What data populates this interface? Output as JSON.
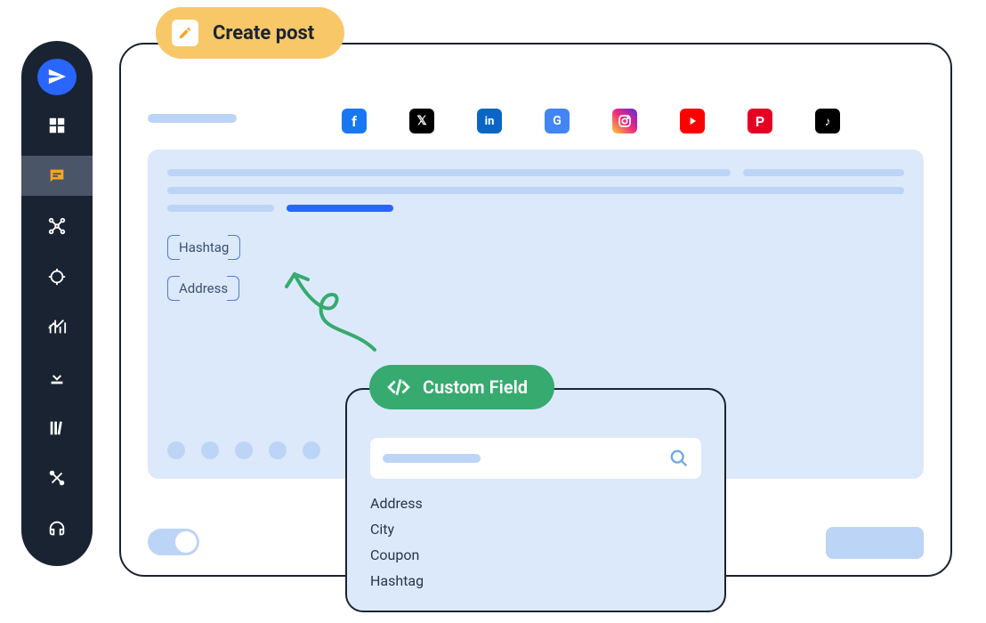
{
  "header": {
    "create_post_label": "Create post"
  },
  "sidebar": {
    "items": [
      {
        "name": "send"
      },
      {
        "name": "dashboard"
      },
      {
        "name": "chat",
        "active": true
      },
      {
        "name": "network"
      },
      {
        "name": "target"
      },
      {
        "name": "analytics"
      },
      {
        "name": "download"
      },
      {
        "name": "library"
      },
      {
        "name": "tools"
      },
      {
        "name": "support"
      }
    ]
  },
  "social_networks": [
    {
      "name": "facebook"
    },
    {
      "name": "x-twitter"
    },
    {
      "name": "linkedin"
    },
    {
      "name": "google-business"
    },
    {
      "name": "instagram"
    },
    {
      "name": "youtube"
    },
    {
      "name": "pinterest"
    },
    {
      "name": "tiktok"
    }
  ],
  "editor": {
    "chips": [
      "Hashtag",
      "Address"
    ]
  },
  "custom_field": {
    "label": "Custom Field",
    "search_placeholder": "",
    "options": [
      "Address",
      "City",
      "Coupon",
      "Hashtag"
    ]
  }
}
